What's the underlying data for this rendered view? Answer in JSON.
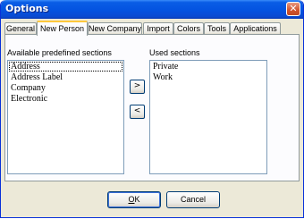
{
  "window": {
    "title": "Options",
    "close_glyph": "✕"
  },
  "tabs": [
    {
      "label": "General"
    },
    {
      "label": "New Person",
      "active": true
    },
    {
      "label": "New Company"
    },
    {
      "label": "Import"
    },
    {
      "label": "Colors"
    },
    {
      "label": "Tools"
    },
    {
      "label": "Applications"
    }
  ],
  "available": {
    "label": "Available predefined sections",
    "items": [
      "Address",
      "Address Label",
      "Company",
      "Electronic"
    ]
  },
  "used": {
    "label": "Used sections",
    "items": [
      "Private",
      "Work"
    ]
  },
  "move_buttons": {
    "add": ">",
    "remove": "<"
  },
  "footer": {
    "ok_label": "OK",
    "cancel_label": "Cancel"
  },
  "colors": {
    "titlebar": "#0453e0",
    "face": "#ece9d8",
    "tab_highlight": "#ffc83c"
  }
}
